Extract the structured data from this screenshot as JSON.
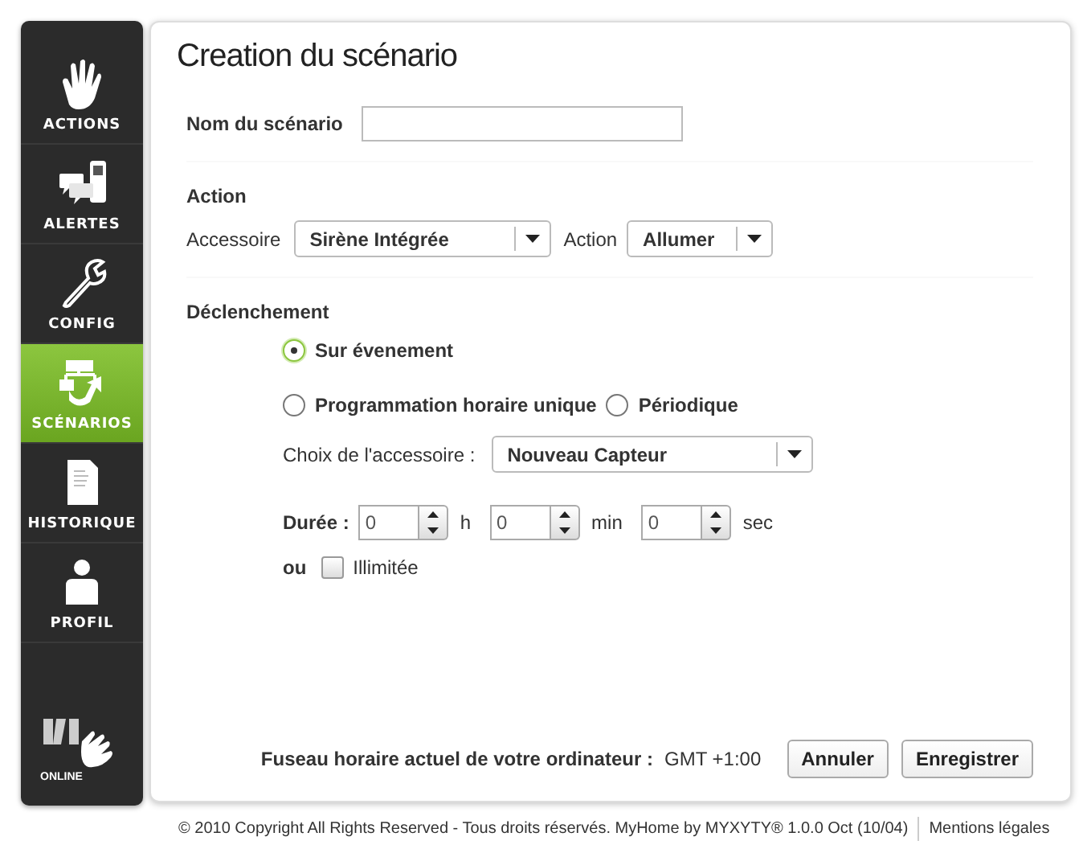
{
  "sidebar": {
    "items": [
      {
        "label": "ACTIONS",
        "selected": false
      },
      {
        "label": "ALERTES",
        "selected": false
      },
      {
        "label": "CONFIG",
        "selected": false
      },
      {
        "label": "SCÉNARIOS",
        "selected": true
      },
      {
        "label": "HISTORIQUE",
        "selected": false
      },
      {
        "label": "PROFIL",
        "selected": false
      }
    ],
    "logo": {
      "text": "ONLINE"
    }
  },
  "page": {
    "title": "Creation du scénario"
  },
  "name_field": {
    "label": "Nom du scénario"
  },
  "action_section": {
    "heading": "Action",
    "accessory": {
      "label": "Accessoire",
      "value": "Sirène Intégrée"
    },
    "action": {
      "label": "Action",
      "value": "Allumer"
    }
  },
  "trigger_section": {
    "heading": "Déclenchement",
    "options": [
      {
        "label": "Sur évenement",
        "selected": true
      },
      {
        "label": "Programmation horaire unique",
        "selected": false
      },
      {
        "label": "Périodique",
        "selected": false
      }
    ],
    "accessory_choice": {
      "label": "Choix de l'accessoire :",
      "value": "Nouveau Capteur"
    },
    "duration": {
      "label": "Durée :",
      "fields": [
        {
          "value": "0",
          "unit": "h"
        },
        {
          "value": "0",
          "unit": "min"
        },
        {
          "value": "0",
          "unit": "sec"
        }
      ]
    },
    "unlimited": {
      "or_label": "ou",
      "label": "Illimitée",
      "checked": false
    }
  },
  "timezone": {
    "label": "Fuseau horaire actuel de votre ordinateur :",
    "value": "GMT +1:00"
  },
  "buttons": [
    "Annuler",
    "Enregistrer"
  ],
  "footer": {
    "copyright": "© 2010 Copyright All Rights Reserved - Tous droits réservés. MyHome by MYXYTY® 1.0.0 Oct (10/04)",
    "link": "Mentions légales"
  }
}
